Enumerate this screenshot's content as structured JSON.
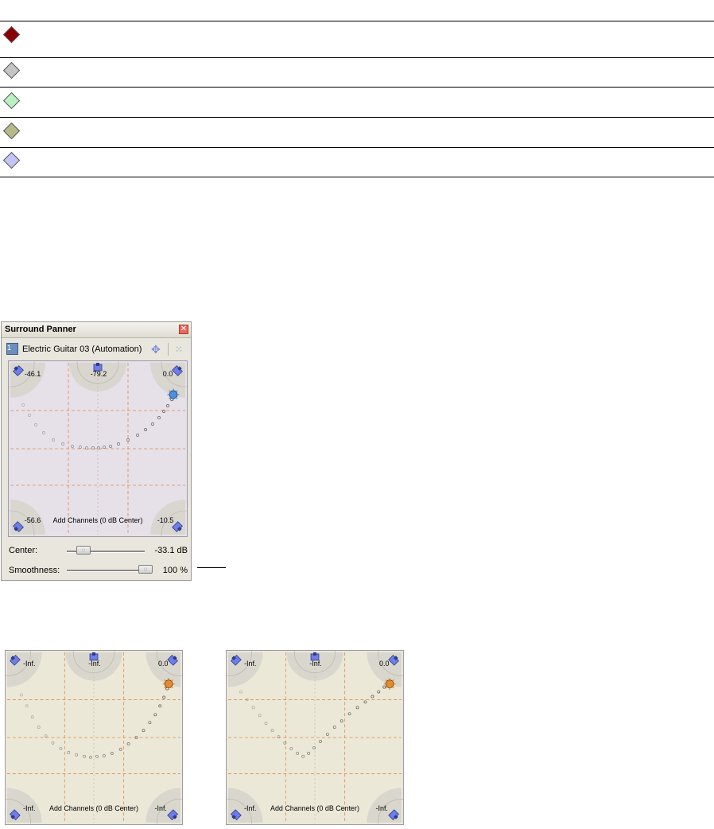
{
  "legend": {
    "colors": [
      "#8b0000",
      "#c4c4c4",
      "#b9f0c4",
      "#b7b98a",
      "#c4c4f6"
    ]
  },
  "panner": {
    "title": "Surround Panner",
    "track_number": "1",
    "track_name": "Electric Guitar 03 (Automation)",
    "channel_values": [
      "-46.1",
      "-79.2",
      "0.0",
      "-56.6",
      "-10.5"
    ],
    "mode_label": "Add Channels (0 dB Center)",
    "center_label": "Center:",
    "center_value": "-33.1 dB",
    "center_level": 0.15,
    "smoothness_label": "Smoothness:",
    "smoothness_value": "100 %",
    "smoothness_level": 1.0
  },
  "example_left": {
    "channel_values": [
      "-Inf.",
      "-Inf.",
      "0.0",
      "-Inf.",
      "-Inf."
    ],
    "mode_label": "Add Channels (0 dB Center)"
  },
  "example_right": {
    "channel_values": [
      "-Inf.",
      "-Inf.",
      "0.0",
      "-Inf.",
      "-Inf."
    ],
    "mode_label": "Add Channels (0 dB Center)"
  }
}
